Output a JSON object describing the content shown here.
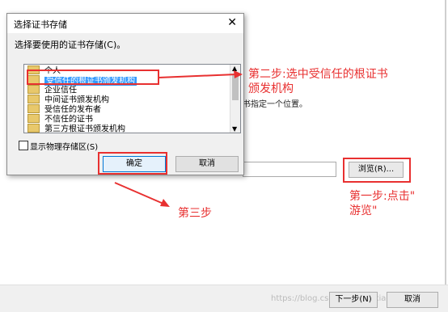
{
  "background": {
    "hint_text": "书指定一个位置。",
    "browse_label": "浏览(R)...",
    "next_label": "下一步(N)",
    "cancel_label": "取消",
    "watermark": "https://blog.csdn.net/xiaoxiaozi"
  },
  "dialog": {
    "title": "选择证书存储",
    "close_glyph": "✕",
    "prompt": "选择要使用的证书存储(C)。",
    "tree_items": [
      {
        "label": "个人",
        "selected": false
      },
      {
        "label": "受信任的根证书颁发机构",
        "selected": true
      },
      {
        "label": "企业信任",
        "selected": false
      },
      {
        "label": "中间证书颁发机构",
        "selected": false
      },
      {
        "label": "受信任的发布者",
        "selected": false
      },
      {
        "label": "不信任的证书",
        "selected": false
      },
      {
        "label": "第三方根证书颁发机构",
        "selected": false
      }
    ],
    "show_physical_label": "显示物理存储区(S)",
    "ok_label": "确定",
    "cancel_label": "取消"
  },
  "annotations": {
    "step2_line1": "第二步:选中受信任的根证书",
    "step2_line2": "颁发机构",
    "step3": "第三步",
    "step1_line1": "第一步:点击\"",
    "step1_line2": "游览\"",
    "color": "#e83030"
  }
}
